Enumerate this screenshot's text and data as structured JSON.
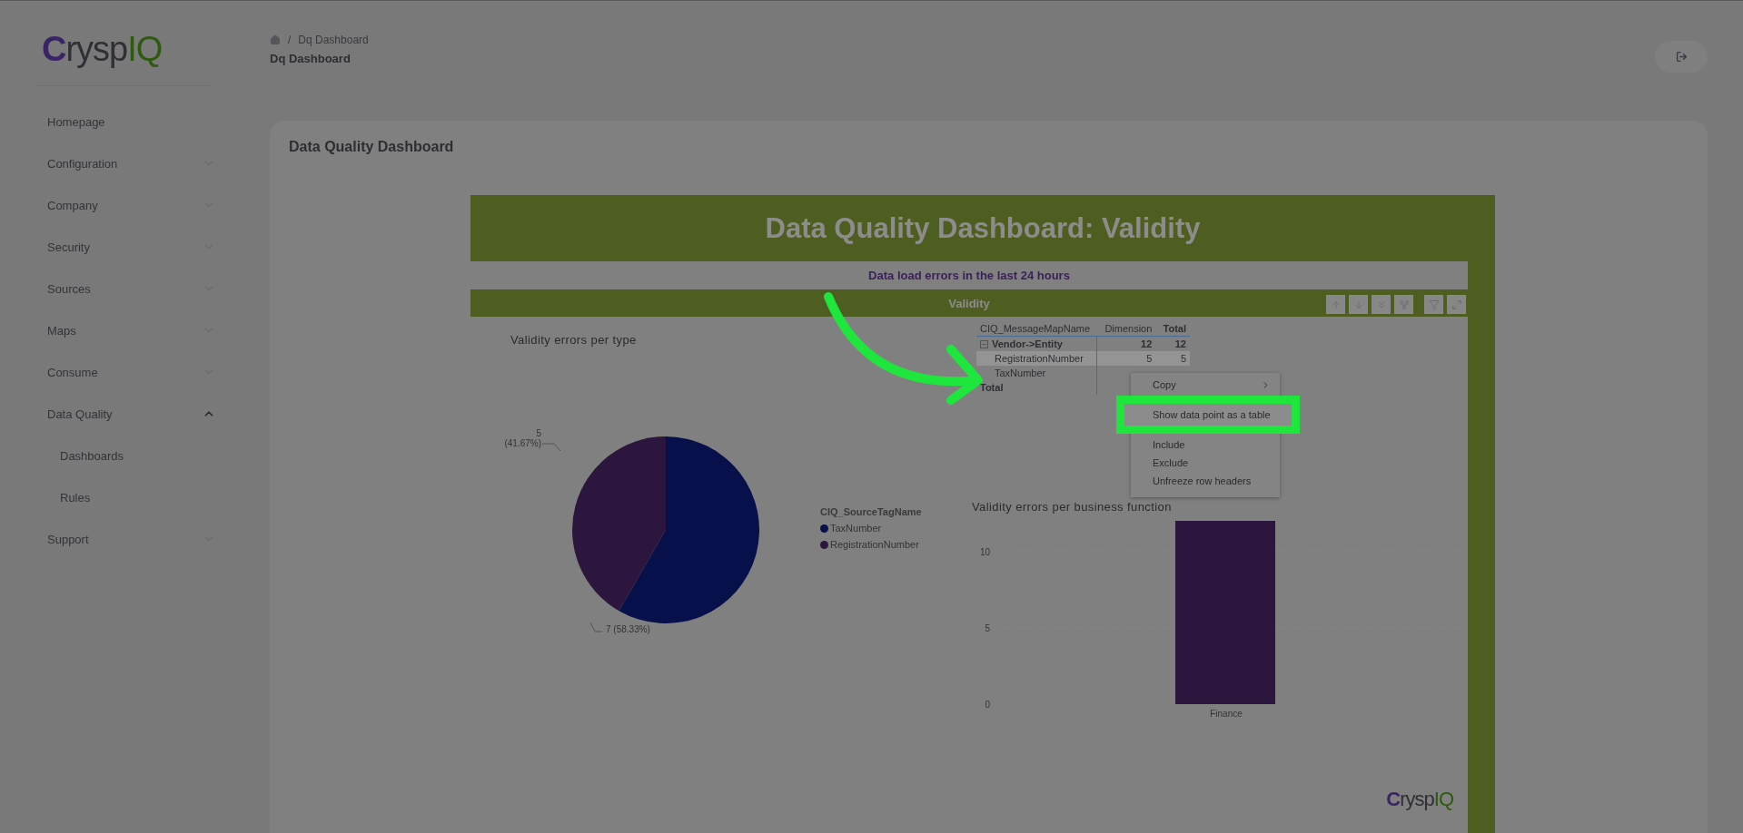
{
  "logo": {
    "text": "Crysp",
    "accent": "IQ"
  },
  "sidebar": {
    "items": [
      {
        "label": "Homepage",
        "expandable": false
      },
      {
        "label": "Configuration",
        "expandable": true,
        "expanded": false
      },
      {
        "label": "Company",
        "expandable": true,
        "expanded": false
      },
      {
        "label": "Security",
        "expandable": true,
        "expanded": false
      },
      {
        "label": "Sources",
        "expandable": true,
        "expanded": false
      },
      {
        "label": "Maps",
        "expandable": true,
        "expanded": false
      },
      {
        "label": "Consume",
        "expandable": true,
        "expanded": false
      },
      {
        "label": "Data Quality",
        "expandable": true,
        "expanded": true,
        "children": [
          {
            "label": "Dashboards"
          },
          {
            "label": "Rules"
          }
        ]
      },
      {
        "label": "Support",
        "expandable": true,
        "expanded": false
      }
    ]
  },
  "breadcrumb": {
    "separator": "/",
    "items": [
      "Dq Dashboard"
    ]
  },
  "page_title": "Dq Dashboard",
  "card": {
    "title": "Data Quality Dashboard"
  },
  "report": {
    "title": "Data Quality Dashboard: Validity",
    "subtitle": "Data load errors in the last 24 hours",
    "section": "Validity",
    "pie_chart": {
      "chart_data": {
        "type": "pie",
        "legend": {
          "title": "CIQ_SourceTagName"
        },
        "title": "Validity errors per type",
        "categories": [
          "TaxNumber",
          "RegistrationNumber"
        ],
        "values": [
          7,
          5
        ],
        "colors": [
          "#07104a",
          "#2c163d"
        ],
        "value_labels": [
          "7 (58.33%)",
          "5 (41.67%)"
        ]
      }
    },
    "matrix": {
      "columns": [
        "CIQ_MessageMapName",
        "Dimension",
        "Total"
      ],
      "rows": [
        {
          "label": "Vendor->Entity",
          "values": [
            "12",
            "12"
          ],
          "expanded": true,
          "selected": false,
          "children": [
            {
              "label": "RegistrationNumber",
              "values": [
                "5",
                "5"
              ],
              "selected": true
            },
            {
              "label": "TaxNumber",
              "selected": false
            }
          ]
        }
      ],
      "total": {
        "label": "Total"
      }
    },
    "bar_chart": {
      "chart_data": {
        "type": "bar",
        "title": "Validity errors per business function",
        "categories": [
          "Finance"
        ],
        "values": [
          12
        ],
        "ylim": [
          0,
          12
        ],
        "yticks": [
          0,
          5,
          10
        ]
      }
    },
    "footer_logo": {
      "text": "Crysp",
      "accent": "IQ"
    }
  },
  "context_menu": {
    "items": [
      {
        "label": "Copy",
        "submenu": true,
        "selected": false
      },
      {
        "label": "Show data point as a table",
        "submenu": false,
        "selected": true
      },
      {
        "label": "Include",
        "submenu": false,
        "selected": false
      },
      {
        "label": "Exclude",
        "submenu": false,
        "selected": false
      },
      {
        "label": "Unfreeze row headers",
        "submenu": false,
        "selected": false
      }
    ]
  }
}
